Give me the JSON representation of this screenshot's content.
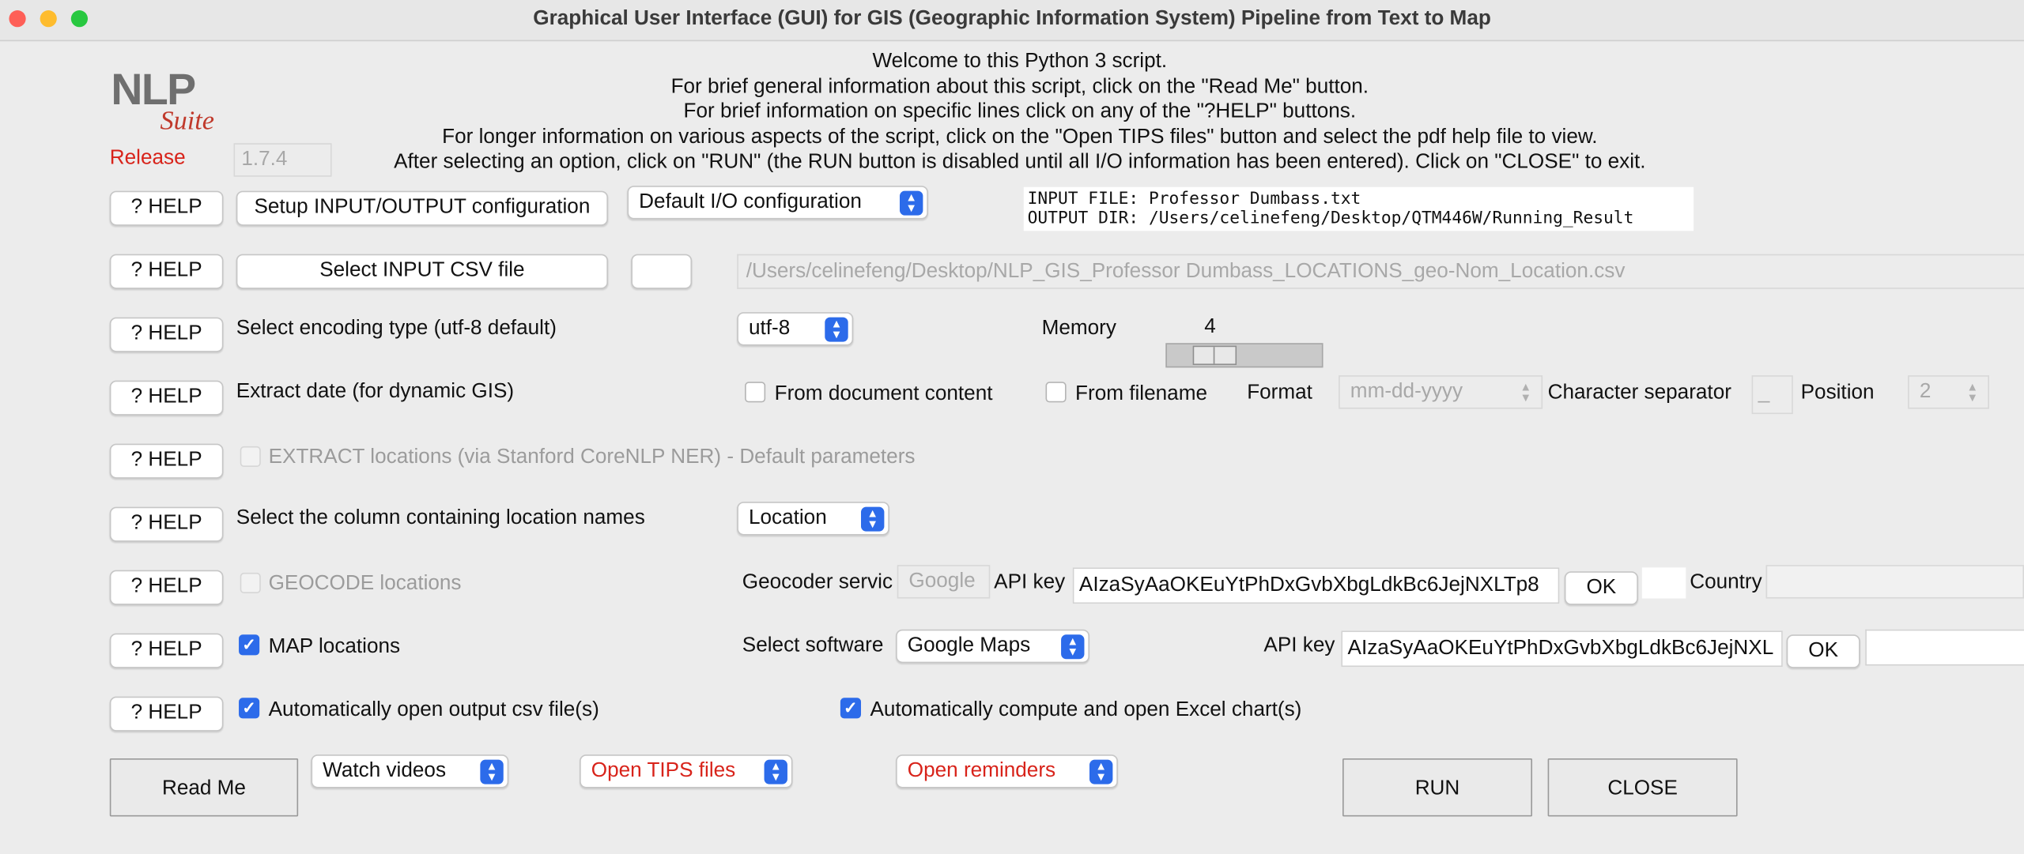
{
  "window": {
    "title": "Graphical User Interface (GUI) for GIS (Geographic Information System) Pipeline from Text to Map"
  },
  "logo": {
    "nlp": "NLP",
    "suite": "Suite"
  },
  "release": {
    "label": "Release",
    "version": "1.7.4"
  },
  "welcome": [
    "Welcome to this Python 3 script.",
    "For brief general information about this script, click on the \"Read Me\" button.",
    "For brief information on specific lines click on any of the \"?HELP\" buttons.",
    "For longer information on various aspects of the script, click on the \"Open TIPS files\" button and select the pdf help file to view.",
    "After selecting an option, click on \"RUN\" (the RUN button is disabled until all I/O information has been entered).   Click on \"CLOSE\" to exit."
  ],
  "help_label": "? HELP",
  "io": {
    "setup_button": "Setup INPUT/OUTPUT configuration",
    "config_select": "Default I/O configuration",
    "input_file": "INPUT FILE: Professor Dumbass.txt",
    "output_dir": "OUTPUT DIR: /Users/celinefeng/Desktop/QTM446W/Running_Result"
  },
  "csv": {
    "select_button": "Select INPUT CSV file",
    "path": "/Users/celinefeng/Desktop/NLP_GIS_Professor Dumbass_LOCATIONS_geo-Nom_Location.csv"
  },
  "encoding": {
    "label": "Select encoding type (utf-8 default)",
    "value": "utf-8",
    "memory_label": "Memory",
    "memory_value": "4"
  },
  "date": {
    "label": "Extract date (for dynamic GIS)",
    "from_content": "From document content",
    "from_filename": "From filename",
    "format_label": "Format",
    "format_value": "mm-dd-yyyy",
    "separator_label": "Character separator",
    "separator_value": "_",
    "position_label": "Position",
    "position_value": "2"
  },
  "extract": {
    "label": "EXTRACT locations (via Stanford CoreNLP NER) - Default parameters"
  },
  "column": {
    "label": "Select the column containing location names",
    "value": "Location"
  },
  "geocode": {
    "label": "GEOCODE locations",
    "service_label": "Geocoder servic",
    "service_value": "Google",
    "api_label": "API key",
    "api_value": "AIzaSyAaOKEuYtPhDxGvbXbgLdkBc6JejNXLTp8",
    "ok": "OK",
    "country_label": "Country"
  },
  "map": {
    "label": "MAP locations",
    "software_label": "Select software",
    "software_value": "Google Maps",
    "api_label": "API key",
    "api_value": "AIzaSyAaOKEuYtPhDxGvbXbgLdkBc6JejNXL",
    "ok": "OK"
  },
  "auto": {
    "open_csv": "Automatically open output csv file(s)",
    "excel": "Automatically compute and open Excel chart(s)"
  },
  "bottom": {
    "readme": "Read Me",
    "videos": "Watch videos",
    "tips": "Open TIPS files",
    "reminders": "Open reminders",
    "run": "RUN",
    "close": "CLOSE"
  },
  "colors": {
    "accent": "#2c6bea",
    "red": "#d8231a"
  }
}
